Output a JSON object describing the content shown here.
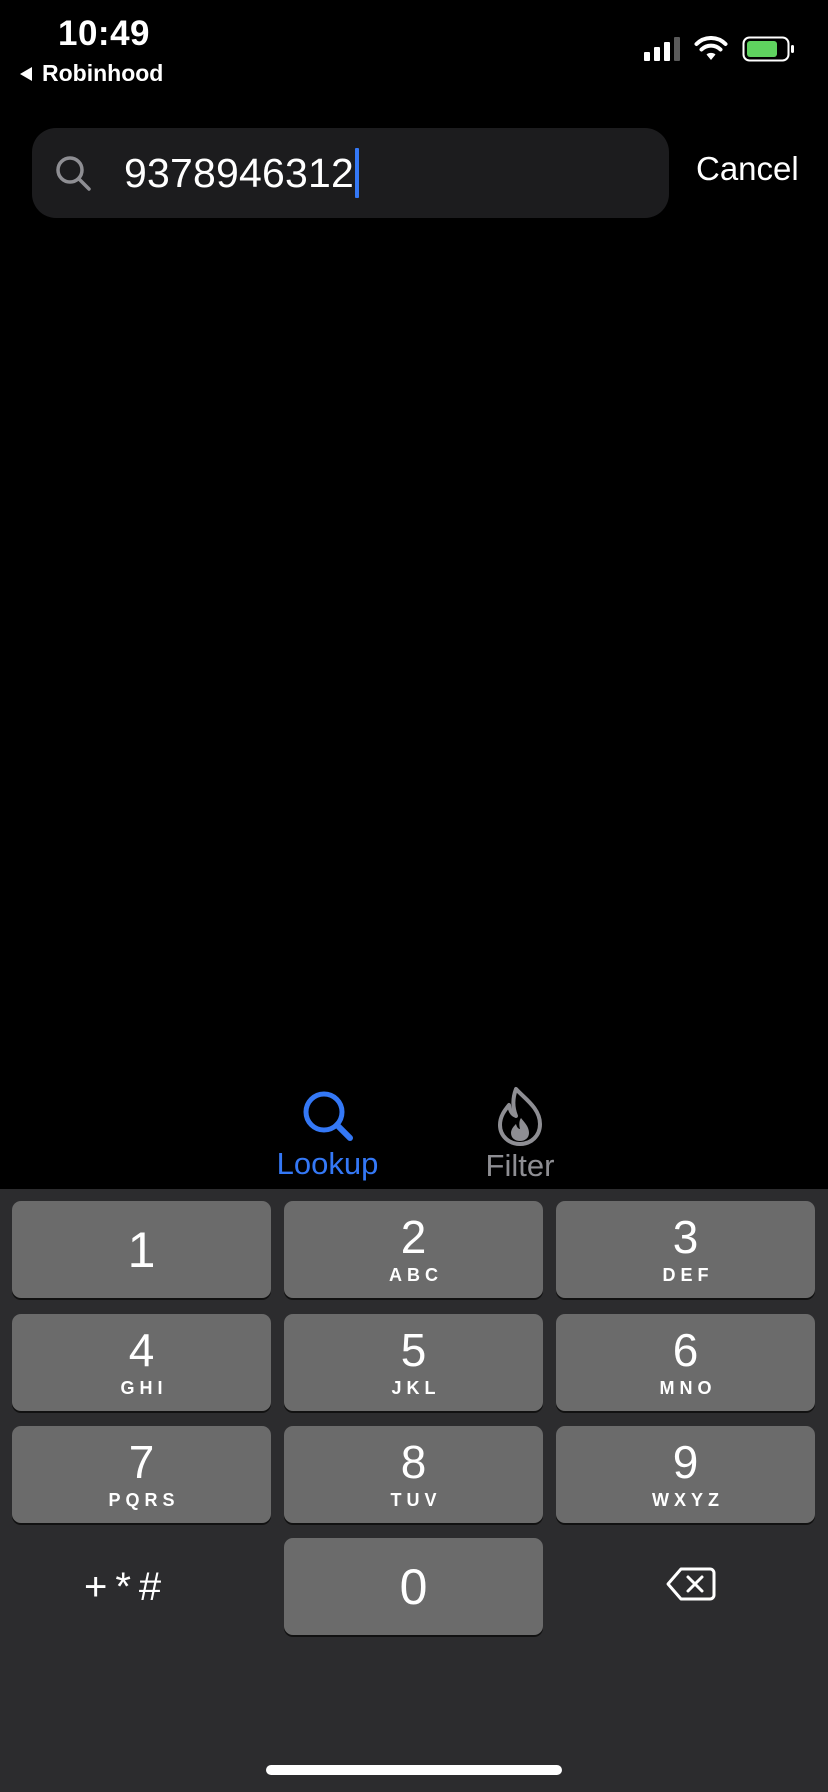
{
  "status_bar": {
    "time": "10:49",
    "back_app": "Robinhood",
    "signal_icon": "cellular-signal-icon",
    "wifi_icon": "wifi-icon",
    "battery_icon": "battery-icon",
    "battery_color": "#5fd35f"
  },
  "search": {
    "icon": "search-icon",
    "value": "9378946312",
    "cancel_label": "Cancel",
    "caret_color": "#3478f6"
  },
  "tabs": [
    {
      "label": "Lookup",
      "icon": "magnifier-icon",
      "active": true,
      "color": "#3478f6"
    },
    {
      "label": "Filter",
      "icon": "flame-icon",
      "active": false,
      "color": "#8e8e93"
    }
  ],
  "keypad": {
    "keys": [
      {
        "digit": "1",
        "letters": ""
      },
      {
        "digit": "2",
        "letters": "ABC"
      },
      {
        "digit": "3",
        "letters": "DEF"
      },
      {
        "digit": "4",
        "letters": "GHI"
      },
      {
        "digit": "5",
        "letters": "JKL"
      },
      {
        "digit": "6",
        "letters": "MNO"
      },
      {
        "digit": "7",
        "letters": "PQRS"
      },
      {
        "digit": "8",
        "letters": "TUV"
      },
      {
        "digit": "9",
        "letters": "WXYZ"
      },
      {
        "digit": "0",
        "letters": ""
      }
    ],
    "symbols_label": "+*#",
    "delete_icon": "backspace-icon"
  }
}
